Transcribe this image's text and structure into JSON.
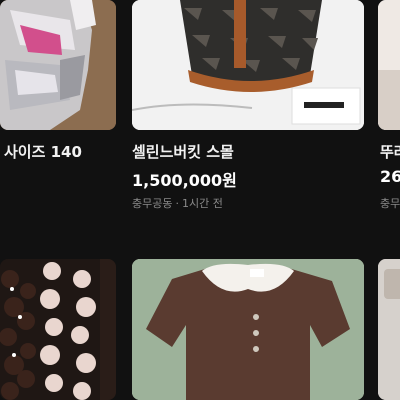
{
  "products": [
    {
      "title": "사이즈 140",
      "price": "",
      "location": "",
      "time": ""
    },
    {
      "title": "셀린느버킷 스몰",
      "price": "1,500,000원",
      "location": "충무공동",
      "time": "1시간 전"
    },
    {
      "title": "뚜러",
      "price": "26",
      "location": "충무",
      "time": ""
    },
    {
      "title": "",
      "price": "",
      "location": "",
      "time": ""
    },
    {
      "title": "",
      "price": "",
      "location": "",
      "time": ""
    },
    {
      "title": "",
      "price": "",
      "location": "",
      "time": ""
    }
  ],
  "separator": "·",
  "colors": {
    "background": "#111111",
    "title": "#f2f2f2",
    "meta": "#8a8a8a"
  }
}
